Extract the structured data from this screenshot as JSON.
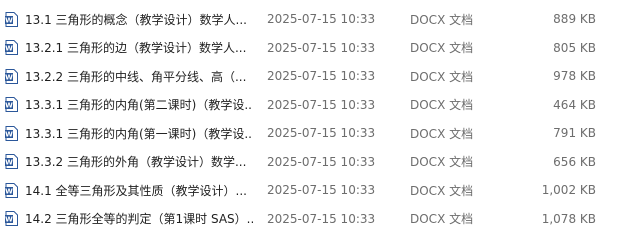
{
  "files": [
    {
      "name": "13.1 三角形的概念（教学设计）数学人...",
      "date": "2025-07-15 10:33",
      "type": "DOCX 文档",
      "size": "889 KB",
      "icon": "word-doc-icon"
    },
    {
      "name": "13.2.1 三角形的边（教学设计）数学人...",
      "date": "2025-07-15 10:33",
      "type": "DOCX 文档",
      "size": "805 KB",
      "icon": "word-doc-icon"
    },
    {
      "name": "13.2.2 三角形的中线、角平分线、高（...",
      "date": "2025-07-15 10:33",
      "type": "DOCX 文档",
      "size": "978 KB",
      "icon": "word-doc-icon"
    },
    {
      "name": "13.3.1 三角形的内角(第二课时)（教学设...",
      "date": "2025-07-15 10:33",
      "type": "DOCX 文档",
      "size": "464 KB",
      "icon": "word-doc-icon"
    },
    {
      "name": "13.3.1 三角形的内角(第一课时)（教学设...",
      "date": "2025-07-15 10:33",
      "type": "DOCX 文档",
      "size": "791 KB",
      "icon": "word-doc-icon"
    },
    {
      "name": "13.3.2 三角形的外角（教学设计）数学...",
      "date": "2025-07-15 10:33",
      "type": "DOCX 文档",
      "size": "656 KB",
      "icon": "word-doc-icon"
    },
    {
      "name": "14.1 全等三角形及其性质（教学设计）...",
      "date": "2025-07-15 10:33",
      "type": "DOCX 文档",
      "size": "1,002 KB",
      "icon": "word-doc-icon"
    },
    {
      "name": "14.2 三角形全等的判定（第1课时 SAS）...",
      "date": "2025-07-15 10:33",
      "type": "DOCX 文档",
      "size": "1,078 KB",
      "icon": "word-doc-icon"
    }
  ],
  "colors": {
    "icon_blue": "#2b579a",
    "icon_light": "#ffffff",
    "meta_text": "#6d6d6d"
  }
}
